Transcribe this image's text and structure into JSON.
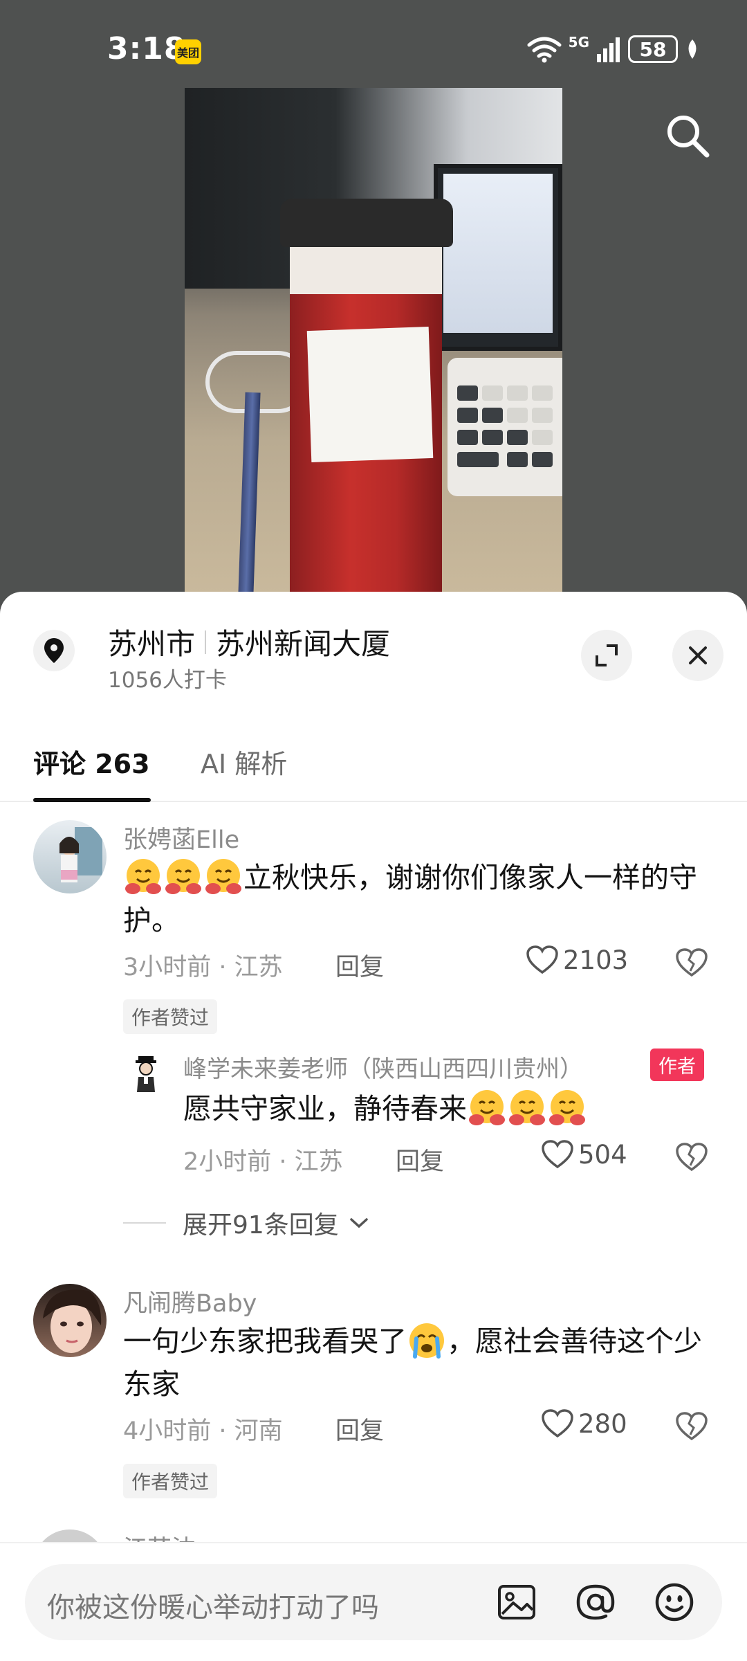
{
  "status_bar": {
    "time": "3:18",
    "app_badge": "美团",
    "network": "5G",
    "battery": "58"
  },
  "location": {
    "city": "苏州市",
    "place": "苏州新闻大厦",
    "checkins": "1056人打卡"
  },
  "tabs": [
    {
      "label": "评论 263",
      "active": true
    },
    {
      "label": "AI 解析",
      "active": false
    }
  ],
  "comments": [
    {
      "username": "张娉菡Elle",
      "text": "立秋快乐，谢谢你们像家人一样的守护。",
      "emoji_prefix": [
        "hug-emoji",
        "hug-emoji",
        "hug-emoji"
      ],
      "time": "3小时前",
      "region": "江苏",
      "reply_label": "回复",
      "likes": "2103",
      "badge": "作者赞过",
      "sub_reply": {
        "username": "峰学未来姜老师（陕西山西四川贵州）",
        "author_tag": "作者",
        "text": "愿共守家业，静待春来",
        "emoji_suffix": [
          "hug-emoji",
          "hug-emoji",
          "hug-emoji"
        ],
        "time": "2小时前",
        "region": "江苏",
        "reply_label": "回复",
        "likes": "504"
      },
      "expand_label": "展开91条回复"
    },
    {
      "username": "凡闹腾Baby",
      "text_part1": "一句少东家把我看哭了",
      "emoji_mid": "crying-emoji",
      "text_part2": "，愿社会善待这个少东家",
      "time": "4小时前",
      "region": "河南",
      "reply_label": "回复",
      "likes": "280",
      "badge": "作者赞过"
    },
    {
      "username": "江苏沈"
    }
  ],
  "input": {
    "placeholder": "你被这份暖心举动打动了吗"
  },
  "colors": {
    "author_tag": "#f2365a",
    "sheet_bg": "#ffffff",
    "top_bg": "#4f5150"
  }
}
